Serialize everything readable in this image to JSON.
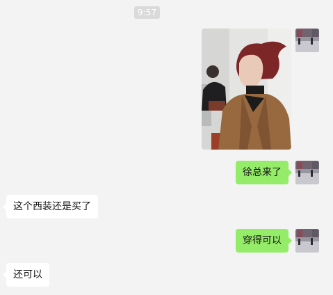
{
  "chat": {
    "timestamp": "9:57",
    "messages": [
      {
        "sender": "me",
        "type": "image",
        "content": "photo of a woman with red hair in a brown blazer"
      },
      {
        "sender": "me",
        "type": "text",
        "text": "徐总来了"
      },
      {
        "sender": "other",
        "type": "text",
        "text": "这个西装还是买了"
      },
      {
        "sender": "me",
        "type": "text",
        "text": "穿得可以"
      },
      {
        "sender": "other",
        "type": "text",
        "text": "还可以"
      }
    ]
  },
  "colors": {
    "background": "#f3f3f3",
    "my_bubble": "#95ec69",
    "other_bubble": "#ffffff",
    "timestamp_bg": "#dadada"
  },
  "icons": {
    "my_avatar": "avatar-street-photo-icon"
  }
}
